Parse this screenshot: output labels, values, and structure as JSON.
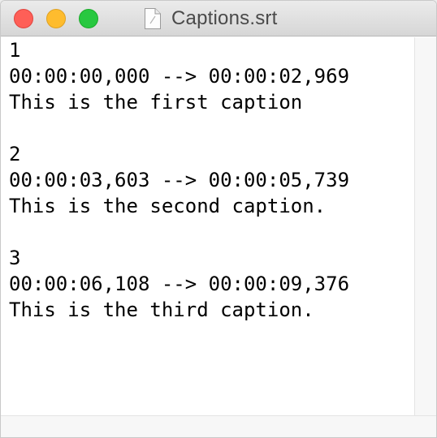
{
  "window": {
    "title": "Captions.srt",
    "file_icon": "document-icon"
  },
  "captions": [
    {
      "index": "1",
      "timing": "00:00:00,000 --> 00:00:02,969",
      "text": "This is the first caption"
    },
    {
      "index": "2",
      "timing": "00:00:03,603 --> 00:00:05,739",
      "text": "This is the second caption."
    },
    {
      "index": "3",
      "timing": "00:00:06,108 --> 00:00:09,376",
      "text": "This is the third caption."
    }
  ],
  "colors": {
    "close": "#fe5f57",
    "minimize": "#febc2e",
    "zoom": "#28c840"
  }
}
